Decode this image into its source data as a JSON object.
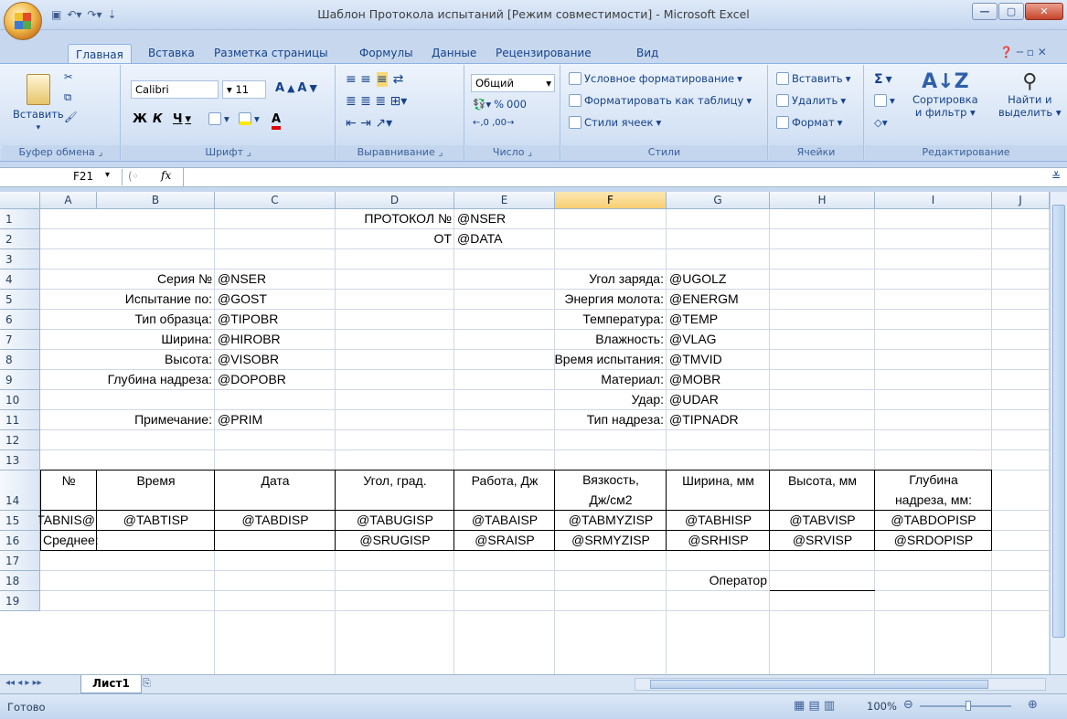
{
  "window": {
    "title": "Шаблон Протокола испытаний  [Режим совместимости] - Microsoft Excel"
  },
  "tabs": [
    "Главная",
    "Вставка",
    "Разметка страницы",
    "Формулы",
    "Данные",
    "Рецензирование",
    "Вид"
  ],
  "ribbon": {
    "clipboard": {
      "paste": "Вставить",
      "label": "Буфер обмена"
    },
    "font": {
      "name": "Calibri",
      "size": "11",
      "bold": "Ж",
      "italic": "К",
      "underline": "Ч",
      "label": "Шрифт"
    },
    "alignment": {
      "label": "Выравнивание"
    },
    "number": {
      "format": "Общий",
      "percent": "%",
      "thousands": "000",
      "label": "Число"
    },
    "styles": {
      "conditional": "Условное форматирование",
      "as_table": "Форматировать как таблицу",
      "cell_styles": "Стили ячеек",
      "label": "Стили"
    },
    "cells": {
      "insert": "Вставить",
      "delete": "Удалить",
      "format": "Формат",
      "label": "Ячейки"
    },
    "editing": {
      "sigma": "Σ",
      "sort1": "Сортировка",
      "sort2": "и фильтр",
      "find1": "Найти и",
      "find2": "выделить",
      "label": "Редактирование"
    }
  },
  "formula_bar": {
    "name_box": "F21",
    "fx": "fx",
    "formula": ""
  },
  "columns": [
    "A",
    "B",
    "C",
    "D",
    "E",
    "F",
    "G",
    "H",
    "I",
    "J"
  ],
  "rows": [
    "1",
    "2",
    "3",
    "4",
    "5",
    "6",
    "7",
    "8",
    "9",
    "10",
    "11",
    "12",
    "13",
    "14",
    "15",
    "16",
    "17",
    "18",
    "19"
  ],
  "cells": {
    "D1": "ПРОТОКОЛ №",
    "E1": "@NSER",
    "D2": "ОТ",
    "E2": "@DATA",
    "B4": "Серия №",
    "C4": "@NSER",
    "F4": "Угол заряда:",
    "G4": "@UGOLZ",
    "B5": "Испытание по:",
    "C5": "@GOST",
    "F5": "Энергия молота:",
    "G5": "@ENERGM",
    "B6": "Тип образца:",
    "C6": "@TIPOBR",
    "F6": "Температура:",
    "G6": "@TEMP",
    "B7": "Ширина:",
    "C7": "@HIROBR",
    "F7": "Влажность:",
    "G7": "@VLAG",
    "B8": "Высота:",
    "C8": "@VISOBR",
    "F8": "Время испытания:",
    "G8": "@TMVID",
    "B9": "Глубина надреза:",
    "C9": "@DOPOBR",
    "F9": "Материал:",
    "G9": "@MOBR",
    "F10": "Удар:",
    "G10": "@UDAR",
    "B11": "Примечание:",
    "C11": "@PRIM",
    "F11": "Тип надреза:",
    "G11": "@TIPNADR",
    "A14": "№",
    "B14": "Время",
    "C14": "Дата",
    "D14": "Угол, град.",
    "E14": "Работа, Дж",
    "F14a": "Вязкость,",
    "F14b": "Дж/см2",
    "G14": "Ширина, мм",
    "H14": "Высота, мм",
    "I14a": "Глубина",
    "I14b": "надреза, мм:",
    "A15": "@TABNIS",
    "B15": "@TABTISP",
    "C15": "@TABDISP",
    "D15": "@TABUGISP",
    "E15": "@TABAISP",
    "F15": "@TABMYZISP",
    "G15": "@TABHISP",
    "H15": "@TABVISP",
    "I15": "@TABDOPISP",
    "A16": "Среднее:",
    "D16": "@SRUGISP",
    "E16": "@SRAISP",
    "F16": "@SRMYZISP",
    "G16": "@SRHISP",
    "H16": "@SRVISP",
    "I16": "@SRDOPISP",
    "G18": "Оператор"
  },
  "sheet_tab": "Лист1",
  "status": {
    "ready": "Готово",
    "zoom": "100%"
  }
}
